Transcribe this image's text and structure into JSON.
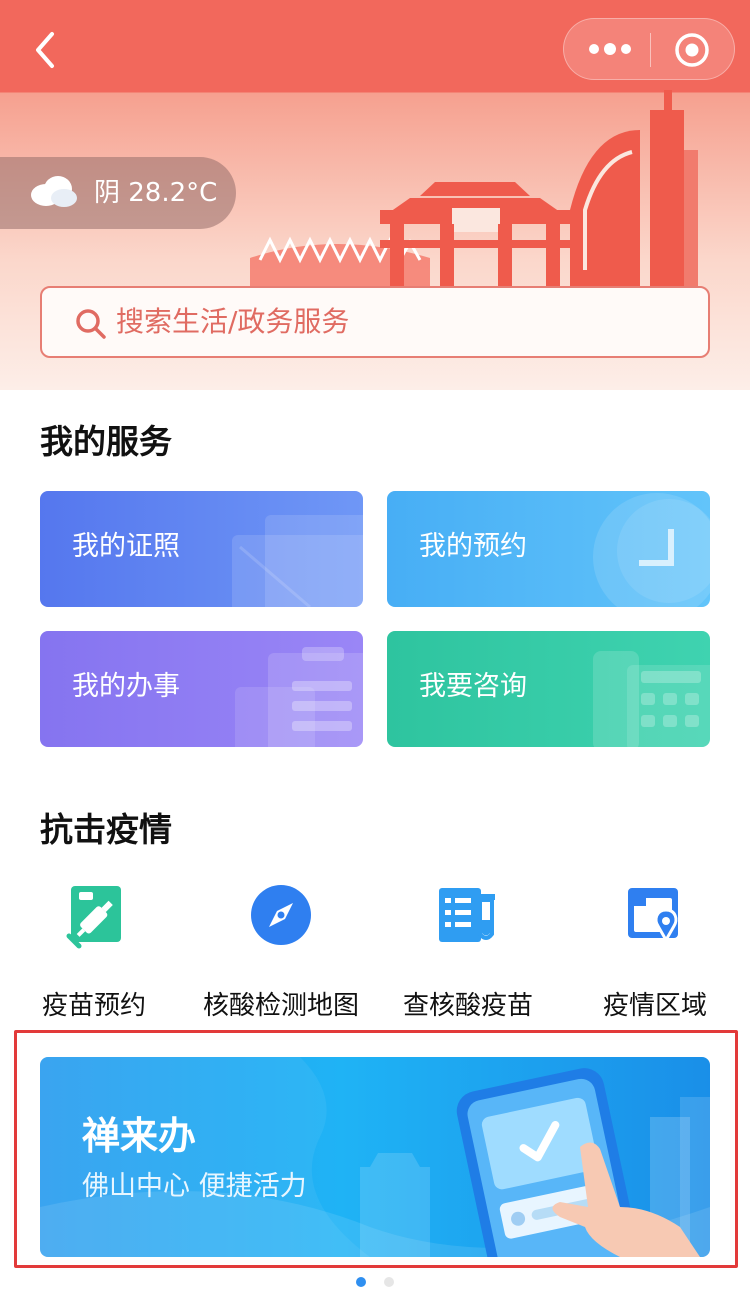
{
  "header": {
    "weather": {
      "icon": "cloud-icon",
      "text": "阴 28.2°C"
    },
    "search": {
      "placeholder": "搜索生活/政务服务"
    }
  },
  "my_services": {
    "title": "我的服务",
    "cards": [
      {
        "label": "我的证照",
        "color": "#5b82f1"
      },
      {
        "label": "我的预约",
        "color": "#4fb5f6"
      },
      {
        "label": "我的办事",
        "color": "#8a78f2"
      },
      {
        "label": "我要咨询",
        "color": "#34c8a6"
      }
    ]
  },
  "epidemic": {
    "title": "抗击疫情",
    "tools": [
      {
        "label": "疫苗预约",
        "icon": "vaccine-icon"
      },
      {
        "label": "核酸检测地图",
        "icon": "compass-icon"
      },
      {
        "label": "查核酸疫苗",
        "icon": "test-tube-icon"
      },
      {
        "label": "疫情区域",
        "icon": "map-pin-icon"
      }
    ]
  },
  "banner": {
    "title": "禅来办",
    "subtitle": "佛山中心  便捷活力"
  },
  "colors": {
    "brand": "#f2685c",
    "highlight_border": "#e23a3a",
    "active_dot": "#2f8ff0"
  }
}
